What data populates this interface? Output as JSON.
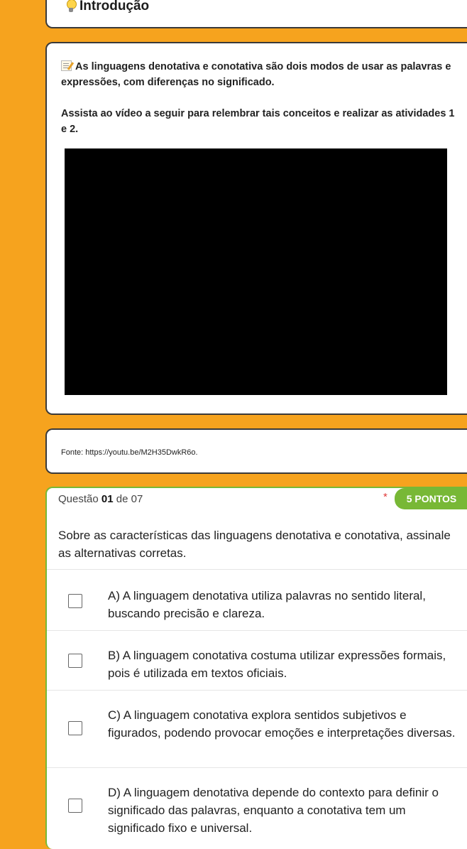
{
  "intro": {
    "title": "Introdução",
    "icon": "light-bulb-icon"
  },
  "video_section": {
    "paragraph1": "As linguagens denotativa e conotativa são dois modos de usar as palavras e expressões, com diferenças no significado.",
    "paragraph1_icon": "memo-icon",
    "paragraph2": "Assista ao vídeo a seguir para relembrar tais conceitos e realizar as atividades 1 e 2."
  },
  "source": {
    "text": "Fonte: https://youtu.be/M2H35DwkR6o."
  },
  "question": {
    "label_prefix": "Questão",
    "number": "01",
    "label_mid": "de",
    "total": "07",
    "required_mark": "*",
    "points": "5 PONTOS",
    "prompt": "Sobre as características das linguagens denotativa e conotativa, assinale as alternativas corretas.",
    "options": [
      {
        "text": "A) A linguagem denotativa utiliza palavras no sentido literal, buscando precisão e clareza."
      },
      {
        "text": "B) A linguagem conotativa costuma utilizar expressões formais, pois é utilizada em textos oficiais."
      },
      {
        "text": "C) A linguagem conotativa explora sentidos subjetivos e figurados, podendo provocar emoções e interpretações diversas."
      },
      {
        "text": "D) A linguagem denotativa depende do contexto para definir o significado das palavras, enquanto a conotativa tem um significado fixo e universal."
      }
    ]
  },
  "colors": {
    "background": "#f6a31e",
    "accent_green": "#78b836",
    "required_red": "#e03a3a"
  }
}
